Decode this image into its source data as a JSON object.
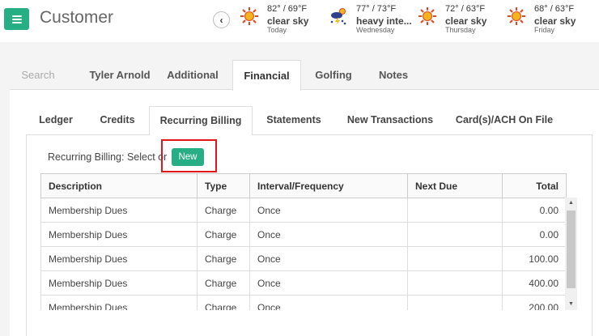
{
  "header": {
    "title": "Customer",
    "back_icon": "chevron-left-icon",
    "weather": [
      {
        "temp": "82° / 69°F",
        "desc": "clear sky",
        "day": "Today",
        "icon": "sun-icon"
      },
      {
        "temp": "77° / 73°F",
        "desc": "heavy inte...",
        "day": "Wednesday",
        "icon": "storm-icon"
      },
      {
        "temp": "72° / 63°F",
        "desc": "clear sky",
        "day": "Thursday",
        "icon": "sun-icon"
      },
      {
        "temp": "68° / 63°F",
        "desc": "clear sky",
        "day": "Friday",
        "icon": "sun-icon"
      }
    ]
  },
  "outer_tabs": [
    "Search",
    "Tyler Arnold",
    "Additional",
    "Financial",
    "Golfing",
    "Notes"
  ],
  "inner_tabs": [
    "Ledger",
    "Credits",
    "Recurring Billing",
    "Statements",
    "New Transactions",
    "Card(s)/ACH On File"
  ],
  "recurring": {
    "label": "Recurring Billing: Select or",
    "new_label": "New"
  },
  "table": {
    "columns": [
      "Description",
      "Type",
      "Interval/Frequency",
      "Next Due",
      "Total"
    ],
    "rows": [
      [
        "Membership Dues",
        "Charge",
        "Once",
        "",
        "0.00"
      ],
      [
        "Membership Dues",
        "Charge",
        "Once",
        "",
        "0.00"
      ],
      [
        "Membership Dues",
        "Charge",
        "Once",
        "",
        "100.00"
      ],
      [
        "Membership Dues",
        "Charge",
        "Once",
        "",
        "400.00"
      ],
      [
        "Membership Dues",
        "Charge",
        "Once",
        "",
        "200.00"
      ]
    ]
  },
  "colors": {
    "accent": "#27ae85",
    "highlight": "#e0161b"
  }
}
